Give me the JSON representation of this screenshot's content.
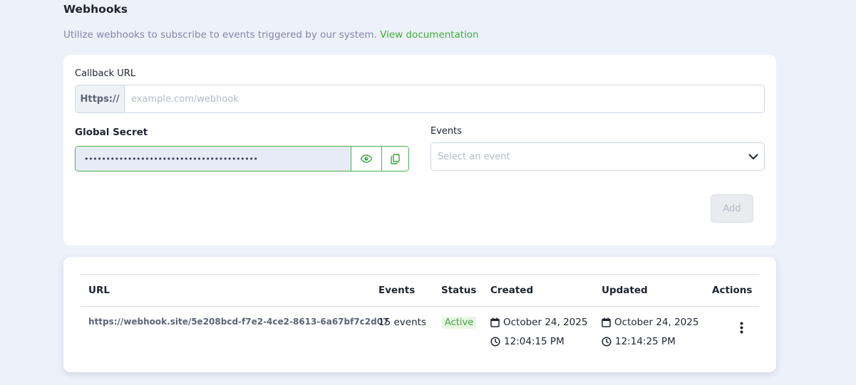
{
  "page": {
    "title": "Webhooks",
    "subtitle": "Utilize webhooks to subscribe to events triggered by our system.",
    "doc_link": "View documentation"
  },
  "form": {
    "callback_label": "Callback URL",
    "url_prefix": "Https://",
    "url_placeholder": "example.com/webhook",
    "url_value": "",
    "secret_label": "Global Secret",
    "secret_value": "••••••••••••••••••••••••••••••••••••••••",
    "events_label": "Events",
    "events_placeholder": "Select an event",
    "add_label": "Add"
  },
  "table": {
    "headers": {
      "url": "URL",
      "events": "Events",
      "status": "Status",
      "created": "Created",
      "updated": "Updated",
      "actions": "Actions"
    },
    "rows": [
      {
        "url": "https://webhook.site/5e208bcd-f7e2-4ce2-8613-6a67bf7c2d07",
        "events": "15 events",
        "status": "Active",
        "created_date": "October 24, 2025",
        "created_time": "12:04:15 PM",
        "updated_date": "October 24, 2025",
        "updated_time": "12:14:25 PM"
      }
    ]
  },
  "icons": {
    "reveal": "eye-icon",
    "copy": "copy-icon",
    "dropdown": "chevron-down-icon",
    "calendar": "calendar-icon",
    "clock": "clock-icon",
    "actions": "more-vertical-icon"
  },
  "colors": {
    "accent": "#3ab03a",
    "page_bg": "#edf1fa",
    "status_active_bg": "#e6f6e3"
  }
}
